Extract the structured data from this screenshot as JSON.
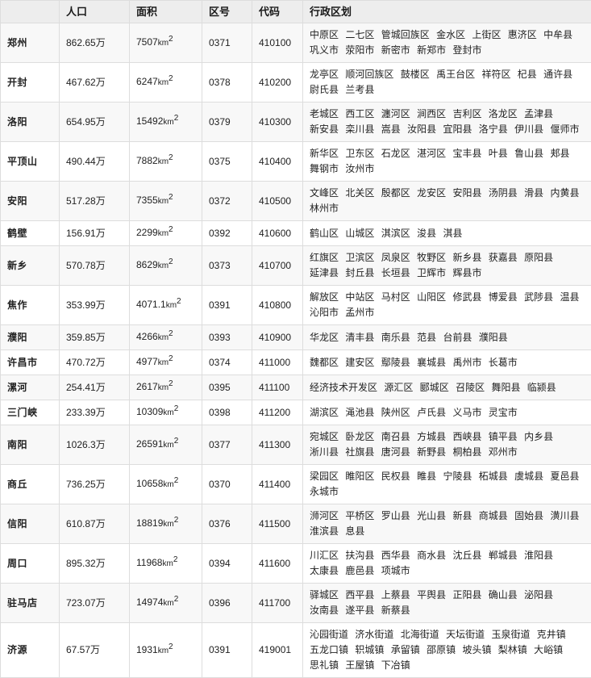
{
  "table": {
    "headers": {
      "name": "",
      "population": "人口",
      "area": "面积",
      "areacode": "区号",
      "adcode": "代码",
      "divisions": "行政区划"
    },
    "area_unit": "km",
    "area_exponent": "2",
    "colors": {
      "link_blue": "#16229c",
      "header_bg": "#ededed",
      "row_alt_bg": "#f8f8f8",
      "border": "#dddddd"
    },
    "rows": [
      {
        "name": "郑州",
        "population": "862.65万",
        "area": "7507",
        "areacode": "0371",
        "adcode": "410100",
        "divisions": [
          "中原区",
          "二七区",
          "管城回族区",
          "金水区",
          "上街区",
          "惠济区",
          "中牟县",
          "巩义市",
          "荥阳市",
          "新密市",
          "新郑市",
          "登封市"
        ]
      },
      {
        "name": "开封",
        "population": "467.62万",
        "area": "6247",
        "areacode": "0378",
        "adcode": "410200",
        "divisions": [
          "龙亭区",
          "顺河回族区",
          "鼓楼区",
          "禹王台区",
          "祥符区",
          "杞县",
          "通许县",
          "尉氏县",
          "兰考县"
        ]
      },
      {
        "name": "洛阳",
        "population": "654.95万",
        "area": "15492",
        "areacode": "0379",
        "adcode": "410300",
        "divisions": [
          "老城区",
          "西工区",
          "瀍河区",
          "涧西区",
          "吉利区",
          "洛龙区",
          "孟津县",
          "新安县",
          "栾川县",
          "嵩县",
          "汝阳县",
          "宜阳县",
          "洛宁县",
          "伊川县",
          "偃师市"
        ]
      },
      {
        "name": "平顶山",
        "population": "490.44万",
        "area": "7882",
        "areacode": "0375",
        "adcode": "410400",
        "divisions": [
          "新华区",
          "卫东区",
          "石龙区",
          "湛河区",
          "宝丰县",
          "叶县",
          "鲁山县",
          "郏县",
          "舞钢市",
          "汝州市"
        ]
      },
      {
        "name": "安阳",
        "population": "517.28万",
        "area": "7355",
        "areacode": "0372",
        "adcode": "410500",
        "divisions": [
          "文峰区",
          "北关区",
          "殷都区",
          "龙安区",
          "安阳县",
          "汤阴县",
          "滑县",
          "内黄县",
          "林州市"
        ]
      },
      {
        "name": "鹤壁",
        "population": "156.91万",
        "area": "2299",
        "areacode": "0392",
        "adcode": "410600",
        "divisions": [
          "鹤山区",
          "山城区",
          "淇滨区",
          "浚县",
          "淇县"
        ]
      },
      {
        "name": "新乡",
        "population": "570.78万",
        "area": "8629",
        "areacode": "0373",
        "adcode": "410700",
        "divisions": [
          "红旗区",
          "卫滨区",
          "凤泉区",
          "牧野区",
          "新乡县",
          "获嘉县",
          "原阳县",
          "延津县",
          "封丘县",
          "长垣县",
          "卫辉市",
          "辉县市"
        ]
      },
      {
        "name": "焦作",
        "population": "353.99万",
        "area": "4071.1",
        "areacode": "0391",
        "adcode": "410800",
        "divisions": [
          "解放区",
          "中站区",
          "马村区",
          "山阳区",
          "修武县",
          "博爱县",
          "武陟县",
          "温县",
          "沁阳市",
          "孟州市"
        ]
      },
      {
        "name": "濮阳",
        "population": "359.85万",
        "area": "4266",
        "areacode": "0393",
        "adcode": "410900",
        "divisions": [
          "华龙区",
          "清丰县",
          "南乐县",
          "范县",
          "台前县",
          "濮阳县"
        ]
      },
      {
        "name": "许昌市",
        "population": "470.72万",
        "area": "4977",
        "areacode": "0374",
        "adcode": "411000",
        "divisions": [
          "魏都区",
          "建安区",
          "鄢陵县",
          "襄城县",
          "禹州市",
          "长葛市"
        ]
      },
      {
        "name": "漯河",
        "population": "254.41万",
        "area": "2617",
        "areacode": "0395",
        "adcode": "411100",
        "divisions": [
          "经济技术开发区",
          "源汇区",
          "郾城区",
          "召陵区",
          "舞阳县",
          "临颍县"
        ]
      },
      {
        "name": "三门峡",
        "population": "233.39万",
        "area": "10309",
        "areacode": "0398",
        "adcode": "411200",
        "divisions": [
          "湖滨区",
          "渑池县",
          "陕州区",
          "卢氏县",
          "义马市",
          "灵宝市"
        ]
      },
      {
        "name": "南阳",
        "population": "1026.3万",
        "area": "26591",
        "areacode": "0377",
        "adcode": "411300",
        "divisions": [
          "宛城区",
          "卧龙区",
          "南召县",
          "方城县",
          "西峡县",
          "镇平县",
          "内乡县",
          "淅川县",
          "社旗县",
          "唐河县",
          "新野县",
          "桐柏县",
          "邓州市"
        ]
      },
      {
        "name": "商丘",
        "population": "736.25万",
        "area": "10658",
        "areacode": "0370",
        "adcode": "411400",
        "divisions": [
          "梁园区",
          "睢阳区",
          "民权县",
          "睢县",
          "宁陵县",
          "柘城县",
          "虞城县",
          "夏邑县",
          "永城市"
        ]
      },
      {
        "name": "信阳",
        "population": "610.87万",
        "area": "18819",
        "areacode": "0376",
        "adcode": "411500",
        "divisions": [
          "浉河区",
          "平桥区",
          "罗山县",
          "光山县",
          "新县",
          "商城县",
          "固始县",
          "潢川县",
          "淮滨县",
          "息县"
        ]
      },
      {
        "name": "周口",
        "population": "895.32万",
        "area": "11968",
        "areacode": "0394",
        "adcode": "411600",
        "divisions": [
          "川汇区",
          "扶沟县",
          "西华县",
          "商水县",
          "沈丘县",
          "郸城县",
          "淮阳县",
          "太康县",
          "鹿邑县",
          "项城市"
        ]
      },
      {
        "name": "驻马店",
        "population": "723.07万",
        "area": "14974",
        "areacode": "0396",
        "adcode": "411700",
        "divisions": [
          "驿城区",
          "西平县",
          "上蔡县",
          "平舆县",
          "正阳县",
          "确山县",
          "泌阳县",
          "汝南县",
          "遂平县",
          "新蔡县"
        ]
      },
      {
        "name": "济源",
        "population": "67.57万",
        "area": "1931",
        "areacode": "0391",
        "adcode": "419001",
        "divisions": [
          "沁园街道",
          "济水街道",
          "北海街道",
          "天坛街道",
          "玉泉街道",
          "克井镇",
          "五龙口镇",
          "轵城镇",
          "承留镇",
          "邵原镇",
          "坡头镇",
          "梨林镇",
          "大峪镇",
          "思礼镇",
          "王屋镇",
          "下冶镇"
        ]
      }
    ]
  }
}
